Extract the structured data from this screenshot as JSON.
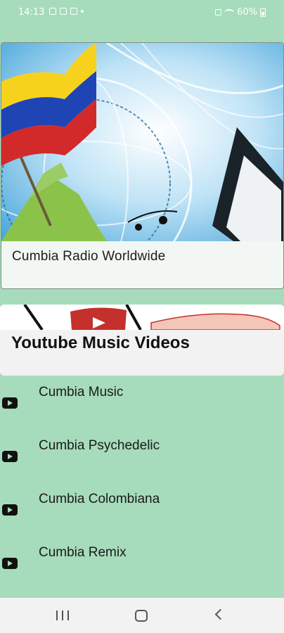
{
  "status_bar": {
    "time": "14:13",
    "battery": "60%"
  },
  "radio_card": {
    "title": "Cumbia Radio Worldwide",
    "image_icon": "colombia-flag-globe-radio-image"
  },
  "youtube_card": {
    "title": "Youtube Music Videos",
    "image_icon": "youtube-logo-banner-image"
  },
  "video_list": {
    "items": [
      {
        "label": "Cumbia Music",
        "icon": "youtube-play-icon"
      },
      {
        "label": "Cumbia Psychedelic",
        "icon": "youtube-play-icon"
      },
      {
        "label": "Cumbia Colombiana",
        "icon": "youtube-play-icon"
      },
      {
        "label": "Cumbia Remix",
        "icon": "youtube-play-icon"
      }
    ]
  },
  "navigation": {
    "recents": "recents-icon",
    "home": "home-icon",
    "back": "back-icon"
  },
  "colors": {
    "background": "#a6dcbb",
    "card": "#f3f7f4",
    "youtube_red": "#c4302b"
  }
}
